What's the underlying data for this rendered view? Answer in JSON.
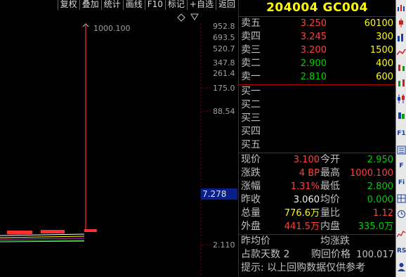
{
  "toolbar": {
    "buttons": [
      "复权",
      "叠加",
      "统计",
      "画线",
      "F10",
      "标记",
      "+自选",
      "返回"
    ]
  },
  "chart": {
    "peak_label": "1000.100",
    "price_axis": [
      "952.8",
      "693.5",
      "520.7",
      "347.8",
      "261.4",
      "175.0",
      "88.54",
      "2.110"
    ],
    "current_price_box": "7.278",
    "colors": {
      "up": "#ff3030",
      "down": "#00d000",
      "grid": "#b00000",
      "highlight": "#0a1f8c"
    }
  },
  "quote": {
    "title": "204004 GC004",
    "sell": [
      {
        "label": "卖五",
        "price": "3.250",
        "volume": "60100",
        "color": "red"
      },
      {
        "label": "卖四",
        "price": "3.245",
        "volume": "300",
        "color": "red"
      },
      {
        "label": "卖三",
        "price": "3.200",
        "volume": "1500",
        "color": "red"
      },
      {
        "label": "卖二",
        "price": "2.900",
        "volume": "400",
        "color": "green"
      },
      {
        "label": "卖一",
        "price": "2.810",
        "volume": "600",
        "color": "green"
      }
    ],
    "buy": [
      {
        "label": "买一",
        "price": "",
        "volume": ""
      },
      {
        "label": "买二",
        "price": "",
        "volume": ""
      },
      {
        "label": "买三",
        "price": "",
        "volume": ""
      },
      {
        "label": "买四",
        "price": "",
        "volume": ""
      },
      {
        "label": "买五",
        "price": "",
        "volume": ""
      }
    ],
    "stats": [
      {
        "l1": "现价",
        "v1": "3.100",
        "c1": "red",
        "l2": "今开",
        "v2": "2.950",
        "c2": "green"
      },
      {
        "l1": "涨跌",
        "v1": "4 BP",
        "c1": "red",
        "l2": "最高",
        "v2": "1000.100",
        "c2": "red"
      },
      {
        "l1": "涨幅",
        "v1": "1.31%",
        "c1": "red",
        "l2": "最低",
        "v2": "2.800",
        "c2": "green"
      },
      {
        "l1": "昨收",
        "v1": "3.060",
        "c1": "white",
        "l2": "均价",
        "v2": "0.000",
        "c2": "green"
      },
      {
        "l1": "总量",
        "v1": "776.6万",
        "c1": "yellow",
        "l2": "量比",
        "v2": "1.12",
        "c2": "red"
      },
      {
        "l1": "外盘",
        "v1": "441.5万",
        "c1": "red",
        "l2": "内盘",
        "v2": "335.0万",
        "c2": "green"
      }
    ],
    "info": {
      "avg_price_label": "昨均价",
      "avg_change_label": "均涨跌",
      "days_label": "占款天数 2",
      "buyback_label": "购回价格",
      "buyback_value": "100.017",
      "hint": "提示: 以上回购数据仅供参考"
    }
  },
  "sidebar_icons": [
    "chart-icon",
    "candle-icon",
    "bar-icon",
    "bar2-icon",
    "line-icon",
    "candle2-icon",
    "candle3-icon",
    "candle4-icon",
    "f10-icon",
    "list-icon",
    "f-icon",
    "grid-icon",
    "f2-icon",
    "clock-icon",
    "calc-icon",
    "graph-icon",
    "rss-icon",
    "user-icon"
  ]
}
